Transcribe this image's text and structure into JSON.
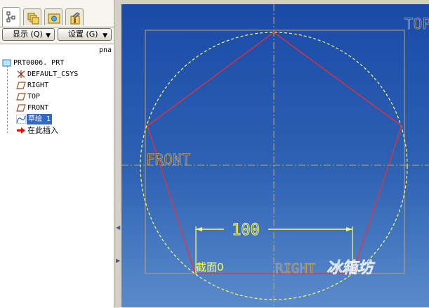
{
  "colors": {
    "datum": "#c9a460",
    "sketch_line": "#ff2020",
    "construction_circle": "#ffff66",
    "dimension": "#ffff66",
    "selection": "#316ac5"
  },
  "toolbar": {
    "show_label": "显示 (Q)",
    "settings_label": "设置 (G)",
    "tabs": [
      "model-tree-icon",
      "layers-icon",
      "favorites-icon",
      "tools-icon"
    ]
  },
  "tree": {
    "column_header": "pna",
    "items": [
      {
        "label": "PRT0006. PRT",
        "icon": "part-icon"
      },
      {
        "label": "DEFAULT_CSYS",
        "icon": "csys-icon"
      },
      {
        "label": "RIGHT",
        "icon": "datum-plane-icon"
      },
      {
        "label": "TOP",
        "icon": "datum-plane-icon"
      },
      {
        "label": "FRONT",
        "icon": "datum-plane-icon"
      },
      {
        "label": "草绘 1",
        "icon": "sketch-icon",
        "selected": true
      },
      {
        "label": "在此插入",
        "icon": "insert-arrow-icon"
      }
    ]
  },
  "graphics": {
    "datum_labels": {
      "top": "TOP",
      "front": "FRONT",
      "right": "RIGHT"
    },
    "dimension_value": "100",
    "section_label": "截面0",
    "watermark": "冰箱坊"
  }
}
